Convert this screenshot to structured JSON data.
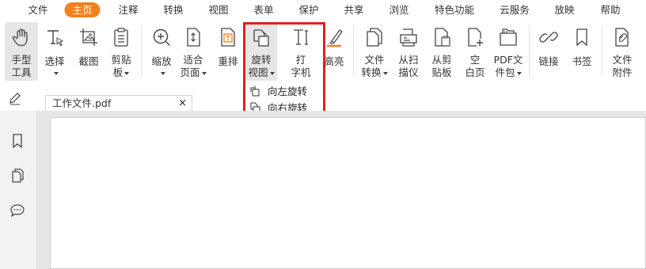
{
  "menu": [
    {
      "label": "文件"
    },
    {
      "label": "主页",
      "active": true
    },
    {
      "label": "注释"
    },
    {
      "label": "转换"
    },
    {
      "label": "视图"
    },
    {
      "label": "表单"
    },
    {
      "label": "保护"
    },
    {
      "label": "共享"
    },
    {
      "label": "浏览"
    },
    {
      "label": "特色功能"
    },
    {
      "label": "云服务"
    },
    {
      "label": "放映"
    },
    {
      "label": "帮助"
    }
  ],
  "ribbon": {
    "hand": "手型\n工具",
    "select": "选择",
    "screenshot": "截图",
    "clipboard": "剪贴\n板",
    "zoom": "缩放",
    "fit": "适合\n页面",
    "reflow": "重排",
    "rotate": "旋转\n视图",
    "typewriter": "打\n字机",
    "highlight": "高亮",
    "file_convert": "文件\n转换",
    "from_scanner": "从扫\n描仪",
    "from_clipboard": "从剪\n贴板",
    "blank_page": "空\n白页",
    "pdf_portfolio": "PDF文\n件包",
    "link": "链接",
    "bookmark": "书签",
    "attachment": "文件\n附件"
  },
  "rotate_menu": {
    "left": "向左旋转",
    "right": "向右旋转"
  },
  "tab": {
    "title": "工作文件.pdf",
    "close": "×"
  },
  "colors": {
    "accent": "#f2811d",
    "highlight_box": "#e0211f"
  }
}
